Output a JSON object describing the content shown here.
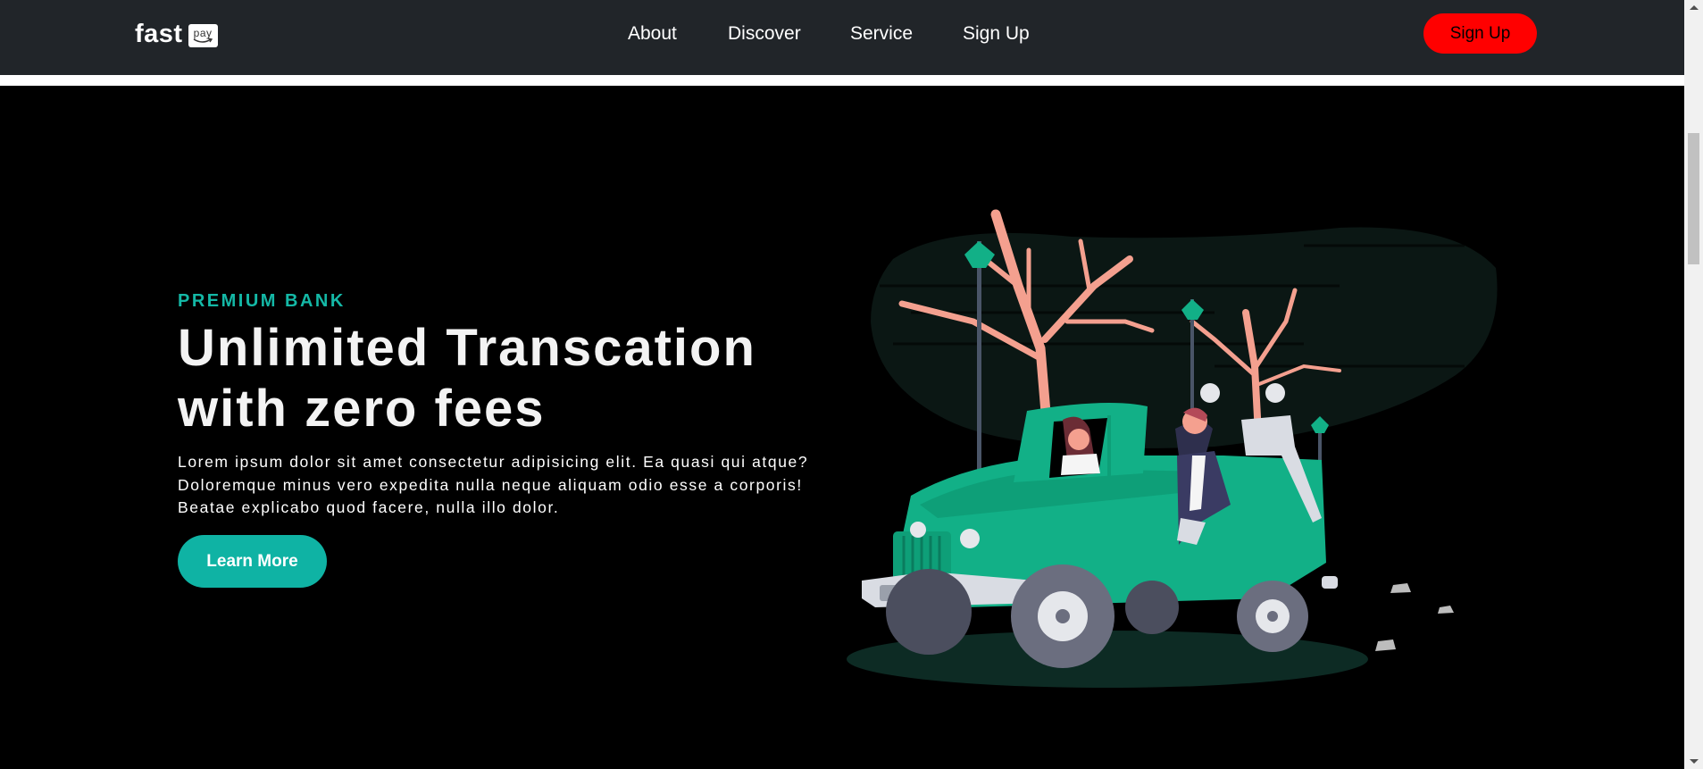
{
  "navbar": {
    "logo_text": "fast",
    "logo_badge": "pay",
    "links": [
      "About",
      "Discover",
      "Service",
      "Sign Up"
    ],
    "signup_button": "Sign Up",
    "signup_color": "#ff0000"
  },
  "hero": {
    "eyebrow": "PREMIUM BANK",
    "headline": "Unlimited Transcation with zero fees",
    "body": "Lorem ipsum dolor sit amet consectetur adipisicing elit. Ea quasi qui atque? Doloremque minus vero expedita nulla neque aliquam odio esse a corporis! Beatae explicabo quod facere, nulla illo dolor.",
    "cta": "Learn More",
    "accent_color": "#14b8a6",
    "illustration": "couple-driving-green-jeep-illustration"
  }
}
